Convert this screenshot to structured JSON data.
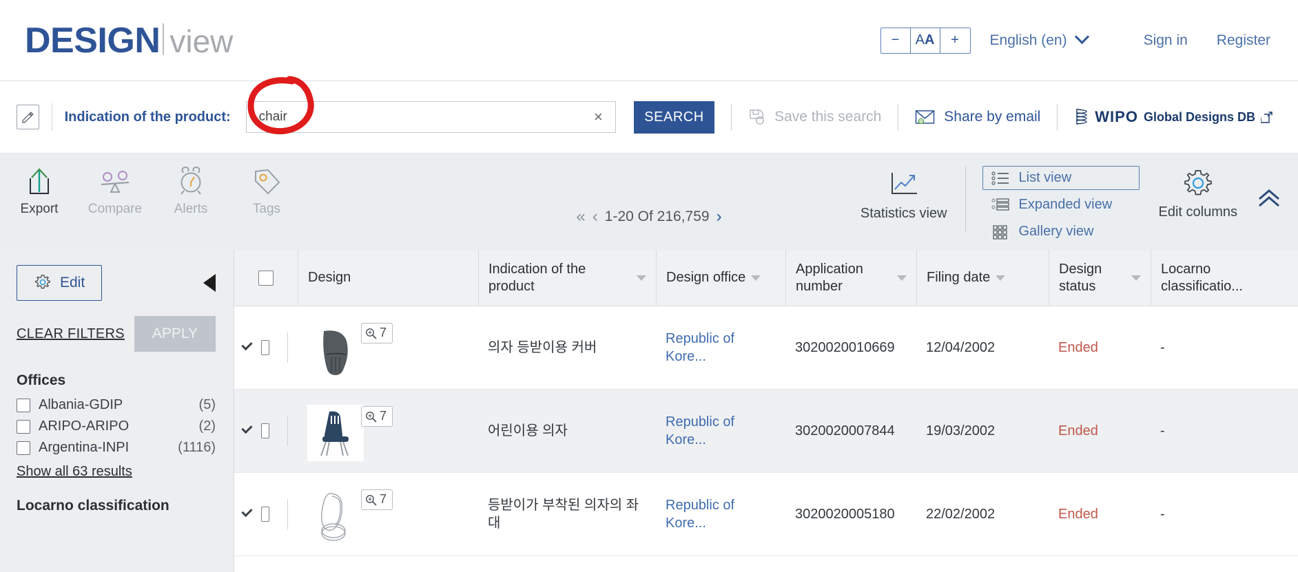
{
  "header": {
    "logo_main": "DESIGN",
    "logo_sub": "view",
    "fontsize": {
      "decrease": "−",
      "reset_small": "A",
      "reset_big": "A",
      "increase": "+"
    },
    "language": "English (en)",
    "sign_in": "Sign in",
    "register": "Register"
  },
  "search": {
    "edit_icon": "pencil-icon",
    "label": "Indication of the product:",
    "value": "chair",
    "placeholder": "",
    "clear": "×",
    "button": "SEARCH",
    "save_search": "Save this search",
    "share_email": "Share by email",
    "wipo_name": "WIPO",
    "wipo_db": "Global Designs DB"
  },
  "toolbar": {
    "actions": [
      {
        "label": "Export",
        "icon": "export-icon",
        "enabled": true
      },
      {
        "label": "Compare",
        "icon": "compare-icon",
        "enabled": false
      },
      {
        "label": "Alerts",
        "icon": "alarm-icon",
        "enabled": false
      },
      {
        "label": "Tags",
        "icon": "tag-icon",
        "enabled": false
      }
    ],
    "pager": {
      "first": "«",
      "prev": "‹",
      "range": "1-20 Of 216,759",
      "next": "›"
    },
    "statistics_view": "Statistics view",
    "views": [
      {
        "label": "List view",
        "icon": "list-view-icon",
        "selected": true
      },
      {
        "label": "Expanded view",
        "icon": "expanded-view-icon",
        "selected": false
      },
      {
        "label": "Gallery view",
        "icon": "gallery-view-icon",
        "selected": false
      }
    ],
    "edit_columns": "Edit columns",
    "collapse": "chevron-double-up-icon"
  },
  "sidebar": {
    "edit_button": "Edit",
    "clear_filters": "CLEAR FILTERS",
    "apply": "APPLY",
    "facets": [
      {
        "title": "Offices",
        "items": [
          {
            "label": "Albania-GDIP",
            "count": "(5)"
          },
          {
            "label": "ARIPO-ARIPO",
            "count": "(2)"
          },
          {
            "label": "Argentina-INPI",
            "count": "(1116)"
          }
        ],
        "show_all": "Show all 63 results"
      },
      {
        "title": "Locarno classification",
        "items": [],
        "show_all": ""
      }
    ]
  },
  "table": {
    "columns": [
      "Design",
      "Indication of the product",
      "Design office",
      "Application number",
      "Filing date",
      "Design status",
      "Locarno classificatio..."
    ],
    "rows": [
      {
        "indication": "의자 등받이용 커버",
        "office": "Republic of Kore...",
        "application_number": "3020020010669",
        "filing_date": "12/04/2002",
        "status": "Ended",
        "locarno": "-",
        "image_count": "7"
      },
      {
        "indication": "어린이용 의자",
        "office": "Republic of Kore...",
        "application_number": "3020020007844",
        "filing_date": "19/03/2002",
        "status": "Ended",
        "locarno": "-",
        "image_count": "7"
      },
      {
        "indication": "등받이가 부착된 의자의 좌대",
        "office": "Republic of Kore...",
        "application_number": "3020020005180",
        "filing_date": "22/02/2002",
        "status": "Ended",
        "locarno": "-",
        "image_count": "7"
      }
    ]
  },
  "annotation": {
    "color": "#e01b1b",
    "shape": "hand-drawn-ellipse"
  }
}
